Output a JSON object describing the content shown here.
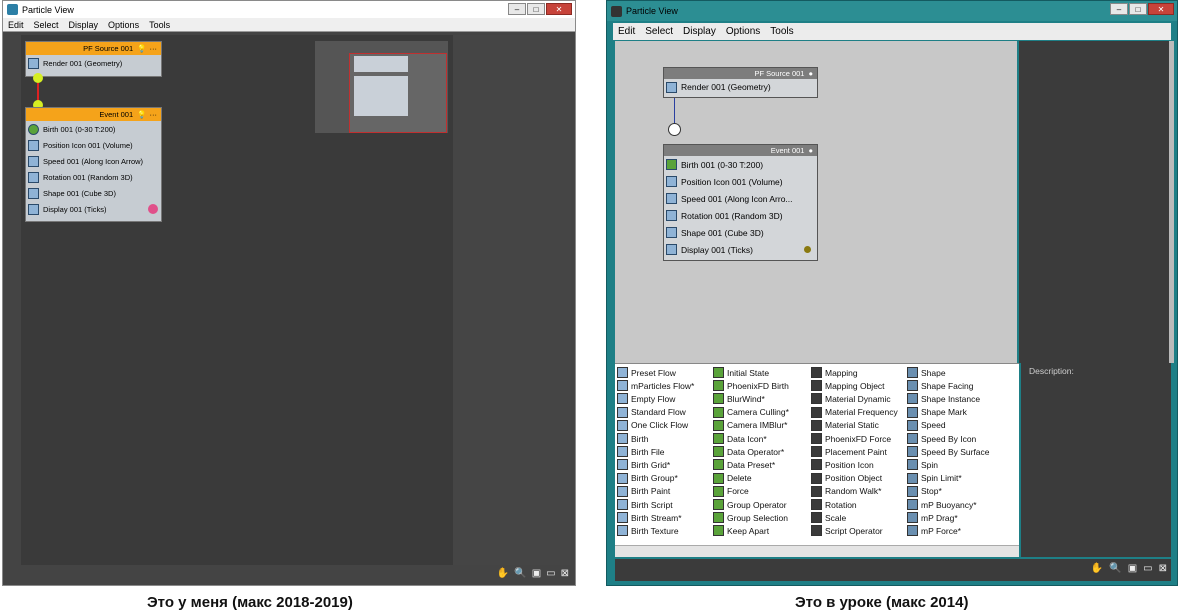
{
  "left": {
    "title": "Particle View",
    "menu": [
      "Edit",
      "Select",
      "Display",
      "Options",
      "Tools"
    ],
    "source_node": {
      "header": "PF Source 001",
      "row": "Render 001 (Geometry)"
    },
    "event_node": {
      "header": "Event 001",
      "rows": [
        "Birth 001 (0-30 T:200)",
        "Position Icon 001 (Volume)",
        "Speed 001 (Along Icon Arrow)",
        "Rotation 001 (Random 3D)",
        "Shape 001 (Cube 3D)",
        "Display 001 (Ticks)"
      ]
    },
    "caption": "Это у меня (макс 2018-2019)"
  },
  "right": {
    "title": "Particle View",
    "menu": [
      "Edit",
      "Select",
      "Display",
      "Options",
      "Tools"
    ],
    "source_node": {
      "header": "PF Source 001",
      "row": "Render 001 (Geometry)"
    },
    "event_node": {
      "header": "Event 001",
      "rows": [
        "Birth 001 (0-30 T:200)",
        "Position Icon 001 (Volume)",
        "Speed 001 (Along Icon Arro...",
        "Rotation 001 (Random 3D)",
        "Shape 001 (Cube 3D)",
        "Display 001 (Ticks)"
      ]
    },
    "description_label": "Description:",
    "depot_columns": [
      [
        "Preset Flow",
        "mParticles Flow*",
        "Empty Flow",
        "Standard Flow",
        "One Click Flow",
        "Birth",
        "Birth File",
        "Birth Grid*",
        "Birth Group*",
        "Birth Paint",
        "Birth Script",
        "Birth Stream*",
        "Birth Texture"
      ],
      [
        "Initial State",
        "PhoenixFD Birth",
        "BlurWind*",
        "Camera Culling*",
        "Camera IMBlur*",
        "Data Icon*",
        "Data Operator*",
        "Data Preset*",
        "Delete",
        "Force",
        "Group Operator",
        "Group Selection",
        "Keep Apart"
      ],
      [
        "Mapping",
        "Mapping Object",
        "Material Dynamic",
        "Material Frequency",
        "Material Static",
        "PhoenixFD Force",
        "Placement Paint",
        "Position Icon",
        "Position Object",
        "Random Walk*",
        "Rotation",
        "Scale",
        "Script Operator"
      ],
      [
        "Shape",
        "Shape Facing",
        "Shape Instance",
        "Shape Mark",
        "Speed",
        "Speed By Icon",
        "Speed By Surface",
        "Spin",
        "Spin Limit*",
        "Stop*",
        "mP Buoyancy*",
        "mP Drag*",
        "mP Force*"
      ]
    ],
    "caption": "Это в уроке (макс 2014)"
  },
  "colors": {
    "orange": "#f5a31a",
    "dark_canvas": "#3a3a3a",
    "grey_canvas": "#c8c8c8",
    "teal_frame": "#1e7f86"
  }
}
